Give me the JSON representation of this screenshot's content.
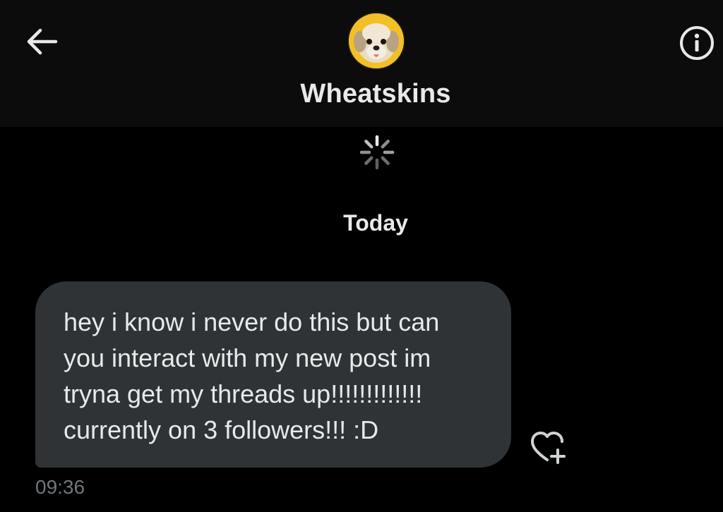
{
  "header": {
    "back_icon": "arrow-left-icon",
    "info_icon": "info-circle-icon",
    "contact_name": "Wheatskins",
    "avatar_icon": "dog-avatar",
    "avatar_bg": "#f2bf26"
  },
  "conversation": {
    "loading_icon": "spinner-icon",
    "day_label": "Today",
    "messages": [
      {
        "lines": [
          "hey i know i never do this but can",
          "you interact with my new post im",
          "tryna get my threads up!!!!!!!!!!!!!",
          "currently on 3 followers!!! :D"
        ],
        "time": "09:36",
        "react_icon": "heart-plus-icon"
      }
    ]
  },
  "colors": {
    "background": "#000000",
    "header_bg": "#0c0c0c",
    "bubble_bg": "#2f3336",
    "text": "#e7e9ea",
    "muted": "#71767b"
  }
}
